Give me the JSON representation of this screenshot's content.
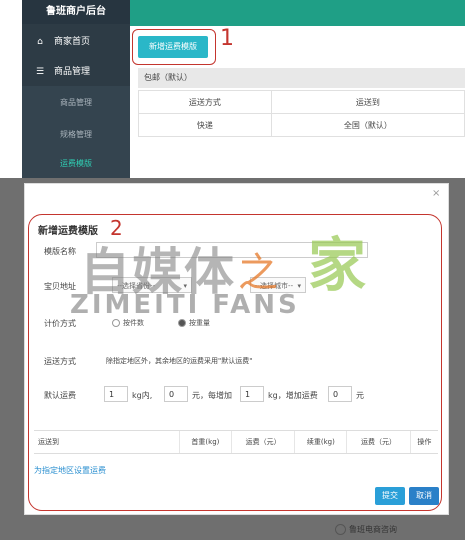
{
  "app": {
    "brand": "鲁班商户后台"
  },
  "sidebar": {
    "items": [
      {
        "label": "商家首页",
        "icon": "home-icon"
      },
      {
        "label": "商品管理",
        "icon": "list-icon"
      }
    ],
    "sub_items": [
      {
        "label": "商品管理"
      },
      {
        "label": "规格管理"
      },
      {
        "label": "运费模版"
      }
    ]
  },
  "main": {
    "new_template_button": "新增运费模版",
    "callout_number_1": "1",
    "rule_card_header": "包邮（默认）",
    "rule_table": {
      "headers": [
        "运送方式",
        "运送到"
      ],
      "rows": [
        [
          "快递",
          "全国（默认）"
        ]
      ]
    }
  },
  "modal": {
    "close": "×",
    "title": "新增运费模版",
    "callout_number_2": "2",
    "template_name_label": "模版名称",
    "ship_from_label": "宝贝地址",
    "province_select": "--选择省份--",
    "city_select": "--选择城市--",
    "pricing_label": "计价方式",
    "pricing_options": [
      "按件数",
      "按重量"
    ],
    "delivery_label": "运送方式",
    "delivery_note": "除指定地区外，其余地区的运费采用\"默认运费\"",
    "default_fee_label": "默认运费",
    "default_fee": {
      "first_value": "1",
      "first_unit": "kg内,",
      "first_price": "0",
      "price_unit": "元，每增加",
      "add_value": "1",
      "add_unit": "kg，增加运费",
      "add_price": "0",
      "add_price_unit": "元"
    },
    "fee_table_headers": [
      "运送到",
      "首重(kg)",
      "运费（元）",
      "续重(kg)",
      "运费（元）",
      "操作"
    ],
    "set_region_link": "为指定地区设置运费",
    "submit_button": "提交",
    "cancel_button": "取消"
  },
  "watermark": {
    "cn": "自媒体",
    "zhi": "之",
    "jia": "家",
    "en": "ZIMEITI FANS"
  },
  "credit": "鲁班电商咨询",
  "colors": {
    "accent": "#1f9f86",
    "callout": "#c4352e",
    "button": "#2ab7c8",
    "link": "#2a8fd0"
  }
}
